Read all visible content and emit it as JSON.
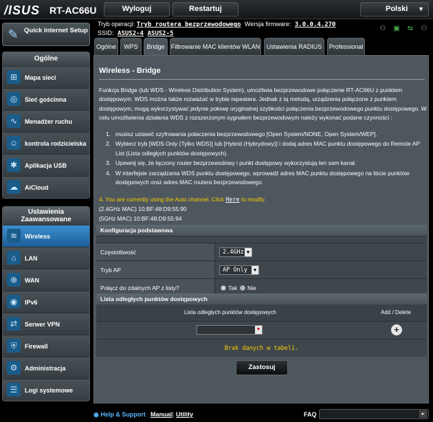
{
  "header": {
    "logo": "/ISUS",
    "model": "RT-AC66U",
    "logout_label": "Wyloguj",
    "restart_label": "Restartuj",
    "language": "Polski"
  },
  "status": {
    "op_mode_label": "Tryb operacji:",
    "op_mode_value": "Tryb routera bezprzewodowego",
    "firmware_label": "Wersja firmware:",
    "firmware_value": "3.0.0.4.270",
    "ssid_label": "SSID:",
    "ssid_1": "ASUS2-4",
    "ssid_2": "ASUS2-5"
  },
  "sidebar": {
    "quick_internet": "Quick Internet Setup",
    "general_header": "Ogólne",
    "general_items": [
      {
        "label": "Mapa sieci",
        "icon": "network-map-icon"
      },
      {
        "label": "Sieć gościnna",
        "icon": "guest-network-icon"
      },
      {
        "label": "Menadżer ruchu",
        "icon": "traffic-manager-icon"
      },
      {
        "label": "kontrola rodzicielska",
        "icon": "parental-control-icon"
      },
      {
        "label": "Aplikacja USB",
        "icon": "usb-icon"
      },
      {
        "label": "AiCloud",
        "icon": "cloud-icon"
      }
    ],
    "advanced_header": "Ustawienia Zaawansowane",
    "advanced_items": [
      {
        "label": "Wireless",
        "icon": "wireless-icon"
      },
      {
        "label": "LAN",
        "icon": "lan-icon"
      },
      {
        "label": "WAN",
        "icon": "wan-icon"
      },
      {
        "label": "IPv6",
        "icon": "ipv6-icon"
      },
      {
        "label": "Serwer VPN",
        "icon": "vpn-icon"
      },
      {
        "label": "Firewall",
        "icon": "firewall-icon"
      },
      {
        "label": "Administracja",
        "icon": "administration-icon"
      },
      {
        "label": "Logi systemowe",
        "icon": "system-log-icon"
      }
    ]
  },
  "tabs": [
    "Ogólne",
    "WPS",
    "Bridge",
    "Filtrowanie MAC klientów WLAN",
    "Ustawienia RADIUS",
    "Professional"
  ],
  "active_tab": "Bridge",
  "page": {
    "title": "Wireless - Bridge",
    "description": "Funkcja Bridge (lub WDS - Wireless Distribution System), umożliwia bezprzewodowe połączenie RT-AC66U z punktem dostępowym. WDS można także rozważać w trybie repeatera. Jednak z tą metodą, urządzenia połączone z punktem dostępowym, mogą wykorzystywać jedynie połowę oryginalnej szybkości połączenia bezprzewodowego punktu dostępowego. W celu umożliwienia działania WDS z rozszerzonym sygnałem bezprzewodowym należy wykonać podane czynności :",
    "steps": [
      "musisz ustawić szyfrowania połaczenia bezprzewodowego [Open System/NONE, Open System/WEP].",
      "Wybierz tryb [WDS Only (Tylko WDS)] lub [Hybrid (Hybrydowy)] i dodaj adres MAC punktu dostępowego do Remote AP List (Lista odległych punktów dostępowych).",
      "Upewnij się, że łączony router bezprzewodowy i punkt dostępowy wykorzystują ten sam kanał.",
      "W interfejsie zarządzania WDS punktu dostępowego, wprowadź adres MAC punktu dostępowego na liście punktów dostępowych oraz adres MAC routera bezprzewodowego."
    ],
    "auto_note_prefix": "4. You are currently using the Auto channel. Click",
    "auto_note_link": "Here",
    "auto_note_suffix": "to modify.",
    "mac_24": "(2.4GHz MAC) 10:BF:48:D9:55:90",
    "mac_5": "(5GHz MAC) 10:BF:48:D9:55:94"
  },
  "basic_config": {
    "header": "Konfiguracja podstawowa",
    "frequency_label": "Częstotliwość",
    "frequency_value": "2.4GHz",
    "ap_mode_label": "Tryb AP",
    "ap_mode_value": "AP Only",
    "connect_label": "Połącz do zdalnych AP z listy?",
    "connect_yes": "Tak",
    "connect_no": "Nie",
    "connect_selected": "Nie"
  },
  "remote_ap": {
    "header": "Lista odległych punktów dostępowych",
    "col_list": "Lista odległych punktów dostępowych",
    "col_action": "Add / Delete",
    "empty_text": "Brak danych w tabeli."
  },
  "apply_label": "Zastosuj",
  "footer": {
    "help": "Help & Support",
    "manual": "Manual",
    "separator": "|",
    "utility": "Utility",
    "faq": "FAQ"
  }
}
